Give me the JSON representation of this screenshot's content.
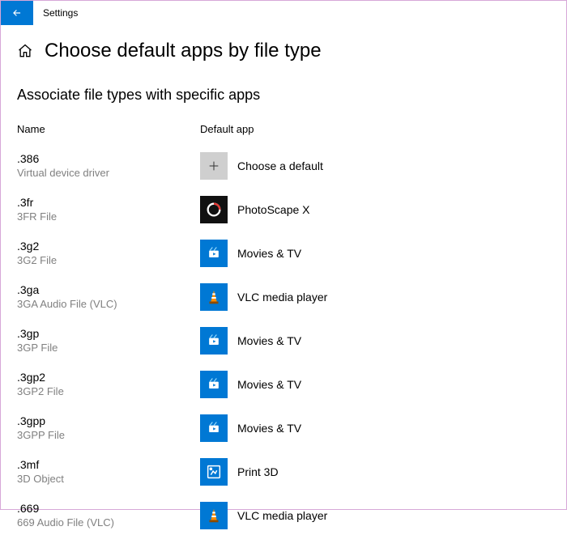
{
  "window": {
    "title": "Settings"
  },
  "header": {
    "page_title": "Choose default apps by file type",
    "subtitle": "Associate file types with specific apps"
  },
  "columns": {
    "name": "Name",
    "default_app": "Default app"
  },
  "rows": [
    {
      "ext": ".386",
      "desc": "Virtual device driver",
      "app": "Choose a default",
      "icon": "plus"
    },
    {
      "ext": ".3fr",
      "desc": "3FR File",
      "app": "PhotoScape X",
      "icon": "photoscape"
    },
    {
      "ext": ".3g2",
      "desc": "3G2 File",
      "app": "Movies & TV",
      "icon": "movies"
    },
    {
      "ext": ".3ga",
      "desc": "3GA Audio File (VLC)",
      "app": "VLC media player",
      "icon": "vlc"
    },
    {
      "ext": ".3gp",
      "desc": "3GP File",
      "app": "Movies & TV",
      "icon": "movies"
    },
    {
      "ext": ".3gp2",
      "desc": "3GP2 File",
      "app": "Movies & TV",
      "icon": "movies"
    },
    {
      "ext": ".3gpp",
      "desc": "3GPP File",
      "app": "Movies & TV",
      "icon": "movies"
    },
    {
      "ext": ".3mf",
      "desc": "3D Object",
      "app": "Print 3D",
      "icon": "print3d"
    },
    {
      "ext": ".669",
      "desc": "669 Audio File (VLC)",
      "app": "VLC media player",
      "icon": "vlc"
    }
  ]
}
